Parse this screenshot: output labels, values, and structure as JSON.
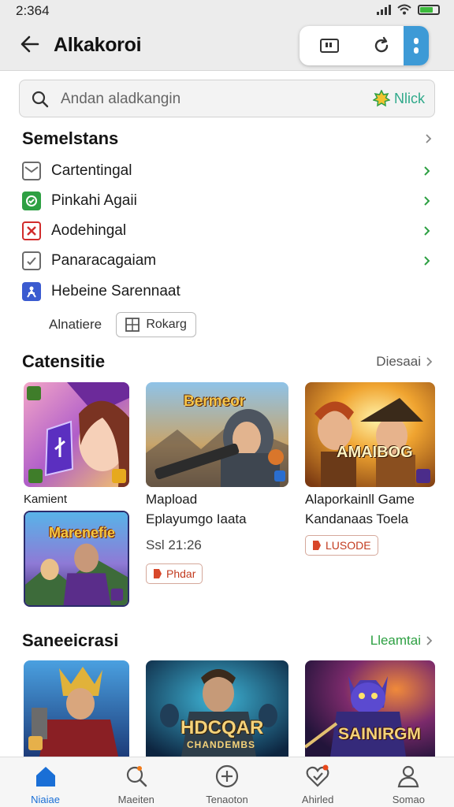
{
  "status": {
    "time": "2:364"
  },
  "app_bar": {
    "title": "Alkakoroi"
  },
  "search": {
    "placeholder": "Andan aladkangin",
    "action_label": "Nlick"
  },
  "section1": {
    "title": "Semelstans",
    "items": [
      {
        "label": "Cartentingal",
        "icon": "mail-icon",
        "color": "#6b6b6b"
      },
      {
        "label": "Pinkahi Agaii",
        "icon": "shield-check-icon",
        "color": "#2ea043"
      },
      {
        "label": "Aodehingal",
        "icon": "x-box-icon",
        "color": "#d12c2c"
      },
      {
        "label": "Panaracagaiam",
        "icon": "check-box-icon",
        "color": "#6b6b6b"
      },
      {
        "label": "Hebeine Sarennaat",
        "icon": "person-icon",
        "color": "#3b5bd0"
      }
    ],
    "alt_label": "Alnatiere",
    "alt_button": "Rokarg"
  },
  "section2": {
    "title": "Catensitie",
    "see_all": "Diesaai",
    "tiles": [
      {
        "caption": "Kamient"
      },
      {
        "art_title": "Bermeor",
        "line1": "Mapload",
        "line2": "Eplayumgo Iaata",
        "time": "Ssl 21:26",
        "badge": "Phdar"
      },
      {
        "art_title": "AMAIBOG",
        "line1": "Alaporkainll Game",
        "line2": "Kandanaas Toela",
        "badge": "LUSODE"
      },
      {
        "art_title": "Marenefie"
      }
    ]
  },
  "section3": {
    "title": "Saneeicrasi",
    "see_all": "Lleamtai",
    "tiles": [
      {
        "art_title": ""
      },
      {
        "art_title": "HDCQAR",
        "art_subtitle": "CHANDEMBS"
      },
      {
        "art_title": "SAINIRGM"
      }
    ]
  },
  "bottom_nav": [
    {
      "label": "Niaiae",
      "icon": "home-icon",
      "active": true
    },
    {
      "label": "Maeiten",
      "icon": "search-person-icon",
      "active": false
    },
    {
      "label": "Tenaoton",
      "icon": "add-circle-icon",
      "active": false
    },
    {
      "label": "Ahirled",
      "icon": "heart-check-icon",
      "active": false
    },
    {
      "label": "Somao",
      "icon": "profile-icon",
      "active": false
    }
  ],
  "colors": {
    "accent": "#1a6fd6",
    "green": "#2ea043",
    "teal": "#2fa98a"
  }
}
